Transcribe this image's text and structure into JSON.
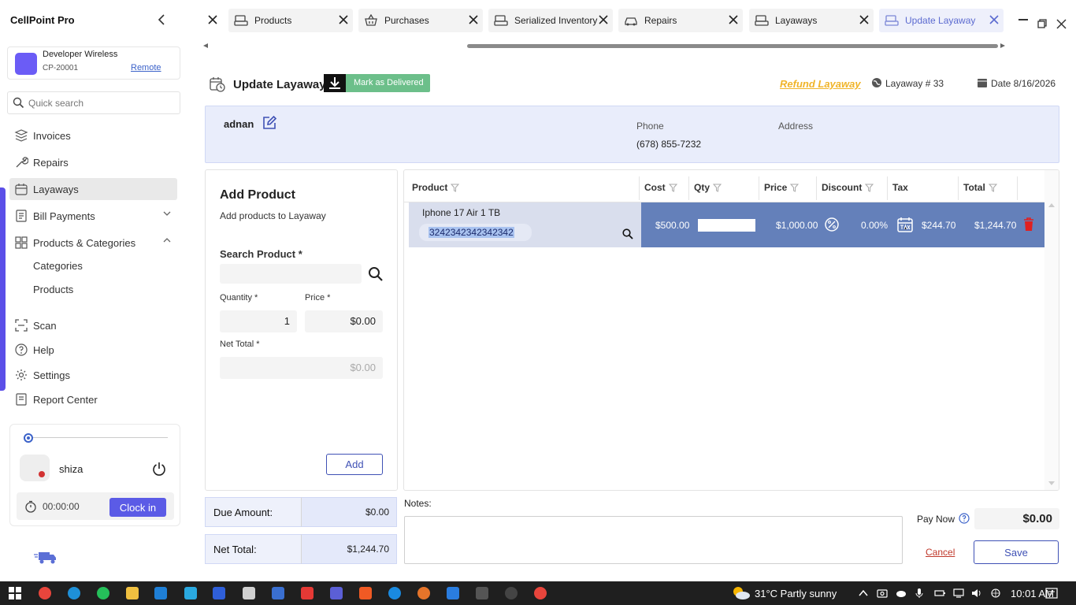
{
  "app": {
    "title": "CellPoint Pro"
  },
  "account": {
    "name": "Developer Wireless",
    "id": "CP-20001",
    "remote_label": "Remote"
  },
  "search": {
    "placeholder": "Quick search"
  },
  "nav": {
    "invoices": "Invoices",
    "repairs": "Repairs",
    "layaways": "Layaways",
    "bill_payments": "Bill Payments",
    "products_categories": "Products & Categories",
    "categories": "Categories",
    "products": "Products",
    "scan": "Scan",
    "help": "Help",
    "settings": "Settings",
    "report_center": "Report Center"
  },
  "user": {
    "name": "shiza",
    "timer": "00:00:00",
    "clock_in_label": "Clock in"
  },
  "tabs": [
    {
      "label": "Products",
      "icon": "register-icon"
    },
    {
      "label": "Purchases",
      "icon": "basket-icon"
    },
    {
      "label": "Serialized Inventory",
      "icon": "register-icon"
    },
    {
      "label": "Repairs",
      "icon": "car-icon"
    },
    {
      "label": "Layaways",
      "icon": "register-icon"
    },
    {
      "label": "Update Layaway",
      "icon": "register-icon"
    }
  ],
  "page": {
    "title": "Update Layaway",
    "mark_delivered_label": "Mark as Delivered",
    "refund_label": "Refund Layaway",
    "layaway_number": "Layaway # 33",
    "date": "Date 8/16/2026"
  },
  "customer": {
    "name": "adnan",
    "phone_label": "Phone",
    "phone": "(678) 855-7232",
    "address_label": "Address"
  },
  "add_product": {
    "title": "Add Product",
    "subtitle": "Add products to Layaway",
    "search_label": "Search Product *",
    "quantity_label": "Quantity *",
    "price_label": "Price *",
    "quantity": "1",
    "price": "$0.00",
    "net_total_label": "Net Total *",
    "net_total": "$0.00",
    "add_label": "Add"
  },
  "grid": {
    "columns": [
      "Product",
      "Cost",
      "Qty",
      "Price",
      "Discount",
      "Tax",
      "Total"
    ],
    "rows": [
      {
        "product": "Iphone 17 Air 1 TB",
        "serial": "3242342342342342",
        "cost": "$500.00",
        "price": "$1,000.00",
        "discount": "0.00%",
        "tax": "$244.70",
        "total": "$1,244.70"
      }
    ]
  },
  "summary": {
    "due_label": "Due Amount:",
    "due_value": "$0.00",
    "net_label": "Net Total:",
    "net_value": "$1,244.70"
  },
  "notes": {
    "label": "Notes:"
  },
  "payment": {
    "pay_now_label": "Pay Now",
    "pay_now_value": "$0.00",
    "cancel_label": "Cancel",
    "save_label": "Save"
  },
  "taskbar": {
    "weather": "31°C  Partly sunny",
    "time": "10:01 AM"
  },
  "colors": {
    "accent": "#5b5be6",
    "delivered": "#6cbf8a",
    "refund": "#f0b429",
    "row_selected": "#6480ba",
    "delete": "#e02020"
  }
}
